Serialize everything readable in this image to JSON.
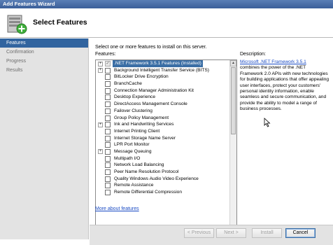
{
  "window": {
    "title": "Add Features Wizard"
  },
  "header": {
    "title": "Select Features",
    "icon": "server-add-icon"
  },
  "steps": [
    {
      "label": "Features",
      "active": true
    },
    {
      "label": "Confirmation",
      "active": false
    },
    {
      "label": "Progress",
      "active": false
    },
    {
      "label": "Results",
      "active": false
    }
  ],
  "main": {
    "instruction": "Select one or more features to install on this server.",
    "features_label": "Features:",
    "description_label": "Description:",
    "features": [
      {
        "label": ".NET Framework 3.5.1 Features  (Installed)",
        "expandable": true,
        "checked": true,
        "disabled": true,
        "selected": true
      },
      {
        "label": "Background Intelligent Transfer Service (BITS)",
        "expandable": true,
        "checked": false
      },
      {
        "label": "BitLocker Drive Encryption",
        "expandable": false,
        "checked": false
      },
      {
        "label": "BranchCache",
        "expandable": false,
        "checked": false
      },
      {
        "label": "Connection Manager Administration Kit",
        "expandable": false,
        "checked": false
      },
      {
        "label": "Desktop Experience",
        "expandable": false,
        "checked": false
      },
      {
        "label": "DirectAccess Management Console",
        "expandable": false,
        "checked": false
      },
      {
        "label": "Failover Clustering",
        "expandable": false,
        "checked": false
      },
      {
        "label": "Group Policy Management",
        "expandable": false,
        "checked": false
      },
      {
        "label": "Ink and Handwriting Services",
        "expandable": true,
        "checked": false
      },
      {
        "label": "Internet Printing Client",
        "expandable": false,
        "checked": false
      },
      {
        "label": "Internet Storage Name Server",
        "expandable": false,
        "checked": false
      },
      {
        "label": "LPR Port Monitor",
        "expandable": false,
        "checked": false
      },
      {
        "label": "Message Queuing",
        "expandable": true,
        "checked": false
      },
      {
        "label": "Multipath I/O",
        "expandable": false,
        "checked": false
      },
      {
        "label": "Network Load Balancing",
        "expandable": false,
        "checked": false
      },
      {
        "label": "Peer Name Resolution Protocol",
        "expandable": false,
        "checked": false
      },
      {
        "label": "Quality Windows Audio Video Experience",
        "expandable": false,
        "checked": false
      },
      {
        "label": "Remote Assistance",
        "expandable": false,
        "checked": false
      },
      {
        "label": "Remote Differential Compression",
        "expandable": false,
        "checked": false
      }
    ],
    "description": {
      "link": "Microsoft .NET Framework 3.5.1",
      "text": "combines the power of the .NET Framework 2.0 APIs with new technologies for building applications that offer appealing user interfaces, protect your customers' personal identity information, enable seamless and secure communication, and provide the ability to model a range of business processes."
    },
    "more_link": "More about features"
  },
  "footer": {
    "previous": "< Previous",
    "next": "Next >",
    "install": "Install",
    "cancel": "Cancel"
  },
  "colors": {
    "accent": "#31649f",
    "link": "#1a4bc4",
    "title_bar": "#3b5f99"
  }
}
